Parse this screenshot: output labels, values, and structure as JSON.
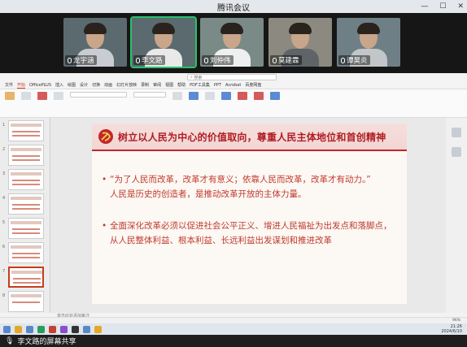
{
  "window": {
    "title": "腾讯会议",
    "controls": [
      "—",
      "☐",
      "✕"
    ]
  },
  "participants": [
    {
      "name": "龙宇涵",
      "active": false
    },
    {
      "name": "李文路",
      "active": true
    },
    {
      "name": "刘仲伟",
      "active": false
    },
    {
      "name": "莫建霖",
      "active": false
    },
    {
      "name": "谭昊炎",
      "active": false
    }
  ],
  "ppt": {
    "search_placeholder": "搜索",
    "menu": [
      "文件",
      "开始",
      "OfficePLUS",
      "插入",
      "绘图",
      "设计",
      "切换",
      "动画",
      "幻灯片放映",
      "录制",
      "审阅",
      "视图",
      "帮助",
      "PDF工具集",
      "PPT",
      "Acrobat",
      "百度网盘"
    ],
    "active_menu": "开始",
    "notes_placeholder": "单击此处添加备注",
    "zoom": "96%"
  },
  "slide": {
    "title": "树立以人民为中心的价值取向，尊重人民主体地位和首创精神",
    "points": [
      {
        "line1": "“为了人民而改革，改革才有意义；依靠人民而改革，改革才有动力。”",
        "line2": "人民是历史的创造者，是推动改革开放的主体力量。"
      },
      {
        "line1": "全面深化改革必须以促进社会公平正义、增进人民福祉为出发点和落脚点，",
        "line2": "从人民整体利益、根本利益、长远利益出发谋划和推进改革"
      }
    ],
    "accent": "#c1272d"
  },
  "taskbar": {
    "time": "21:26",
    "date": "2024/6/10"
  },
  "share_bar": {
    "label": "李文路的屏幕共享"
  }
}
